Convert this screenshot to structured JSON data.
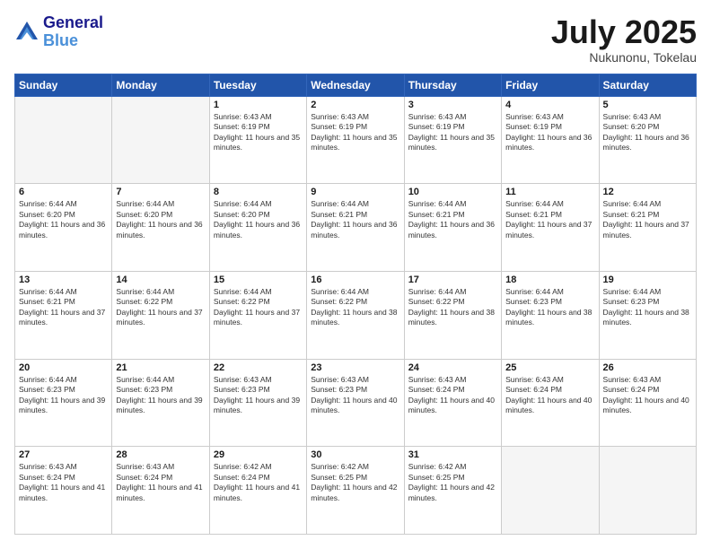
{
  "header": {
    "logo_line1": "General",
    "logo_line2": "Blue",
    "month": "July 2025",
    "location": "Nukunonu, Tokelau"
  },
  "weekdays": [
    "Sunday",
    "Monday",
    "Tuesday",
    "Wednesday",
    "Thursday",
    "Friday",
    "Saturday"
  ],
  "weeks": [
    [
      {
        "day": "",
        "info": ""
      },
      {
        "day": "",
        "info": ""
      },
      {
        "day": "1",
        "info": "Sunrise: 6:43 AM\nSunset: 6:19 PM\nDaylight: 11 hours and 35 minutes."
      },
      {
        "day": "2",
        "info": "Sunrise: 6:43 AM\nSunset: 6:19 PM\nDaylight: 11 hours and 35 minutes."
      },
      {
        "day": "3",
        "info": "Sunrise: 6:43 AM\nSunset: 6:19 PM\nDaylight: 11 hours and 35 minutes."
      },
      {
        "day": "4",
        "info": "Sunrise: 6:43 AM\nSunset: 6:19 PM\nDaylight: 11 hours and 36 minutes."
      },
      {
        "day": "5",
        "info": "Sunrise: 6:43 AM\nSunset: 6:20 PM\nDaylight: 11 hours and 36 minutes."
      }
    ],
    [
      {
        "day": "6",
        "info": "Sunrise: 6:44 AM\nSunset: 6:20 PM\nDaylight: 11 hours and 36 minutes."
      },
      {
        "day": "7",
        "info": "Sunrise: 6:44 AM\nSunset: 6:20 PM\nDaylight: 11 hours and 36 minutes."
      },
      {
        "day": "8",
        "info": "Sunrise: 6:44 AM\nSunset: 6:20 PM\nDaylight: 11 hours and 36 minutes."
      },
      {
        "day": "9",
        "info": "Sunrise: 6:44 AM\nSunset: 6:21 PM\nDaylight: 11 hours and 36 minutes."
      },
      {
        "day": "10",
        "info": "Sunrise: 6:44 AM\nSunset: 6:21 PM\nDaylight: 11 hours and 36 minutes."
      },
      {
        "day": "11",
        "info": "Sunrise: 6:44 AM\nSunset: 6:21 PM\nDaylight: 11 hours and 37 minutes."
      },
      {
        "day": "12",
        "info": "Sunrise: 6:44 AM\nSunset: 6:21 PM\nDaylight: 11 hours and 37 minutes."
      }
    ],
    [
      {
        "day": "13",
        "info": "Sunrise: 6:44 AM\nSunset: 6:21 PM\nDaylight: 11 hours and 37 minutes."
      },
      {
        "day": "14",
        "info": "Sunrise: 6:44 AM\nSunset: 6:22 PM\nDaylight: 11 hours and 37 minutes."
      },
      {
        "day": "15",
        "info": "Sunrise: 6:44 AM\nSunset: 6:22 PM\nDaylight: 11 hours and 37 minutes."
      },
      {
        "day": "16",
        "info": "Sunrise: 6:44 AM\nSunset: 6:22 PM\nDaylight: 11 hours and 38 minutes."
      },
      {
        "day": "17",
        "info": "Sunrise: 6:44 AM\nSunset: 6:22 PM\nDaylight: 11 hours and 38 minutes."
      },
      {
        "day": "18",
        "info": "Sunrise: 6:44 AM\nSunset: 6:23 PM\nDaylight: 11 hours and 38 minutes."
      },
      {
        "day": "19",
        "info": "Sunrise: 6:44 AM\nSunset: 6:23 PM\nDaylight: 11 hours and 38 minutes."
      }
    ],
    [
      {
        "day": "20",
        "info": "Sunrise: 6:44 AM\nSunset: 6:23 PM\nDaylight: 11 hours and 39 minutes."
      },
      {
        "day": "21",
        "info": "Sunrise: 6:44 AM\nSunset: 6:23 PM\nDaylight: 11 hours and 39 minutes."
      },
      {
        "day": "22",
        "info": "Sunrise: 6:43 AM\nSunset: 6:23 PM\nDaylight: 11 hours and 39 minutes."
      },
      {
        "day": "23",
        "info": "Sunrise: 6:43 AM\nSunset: 6:23 PM\nDaylight: 11 hours and 40 minutes."
      },
      {
        "day": "24",
        "info": "Sunrise: 6:43 AM\nSunset: 6:24 PM\nDaylight: 11 hours and 40 minutes."
      },
      {
        "day": "25",
        "info": "Sunrise: 6:43 AM\nSunset: 6:24 PM\nDaylight: 11 hours and 40 minutes."
      },
      {
        "day": "26",
        "info": "Sunrise: 6:43 AM\nSunset: 6:24 PM\nDaylight: 11 hours and 40 minutes."
      }
    ],
    [
      {
        "day": "27",
        "info": "Sunrise: 6:43 AM\nSunset: 6:24 PM\nDaylight: 11 hours and 41 minutes."
      },
      {
        "day": "28",
        "info": "Sunrise: 6:43 AM\nSunset: 6:24 PM\nDaylight: 11 hours and 41 minutes."
      },
      {
        "day": "29",
        "info": "Sunrise: 6:42 AM\nSunset: 6:24 PM\nDaylight: 11 hours and 41 minutes."
      },
      {
        "day": "30",
        "info": "Sunrise: 6:42 AM\nSunset: 6:25 PM\nDaylight: 11 hours and 42 minutes."
      },
      {
        "day": "31",
        "info": "Sunrise: 6:42 AM\nSunset: 6:25 PM\nDaylight: 11 hours and 42 minutes."
      },
      {
        "day": "",
        "info": ""
      },
      {
        "day": "",
        "info": ""
      }
    ]
  ]
}
